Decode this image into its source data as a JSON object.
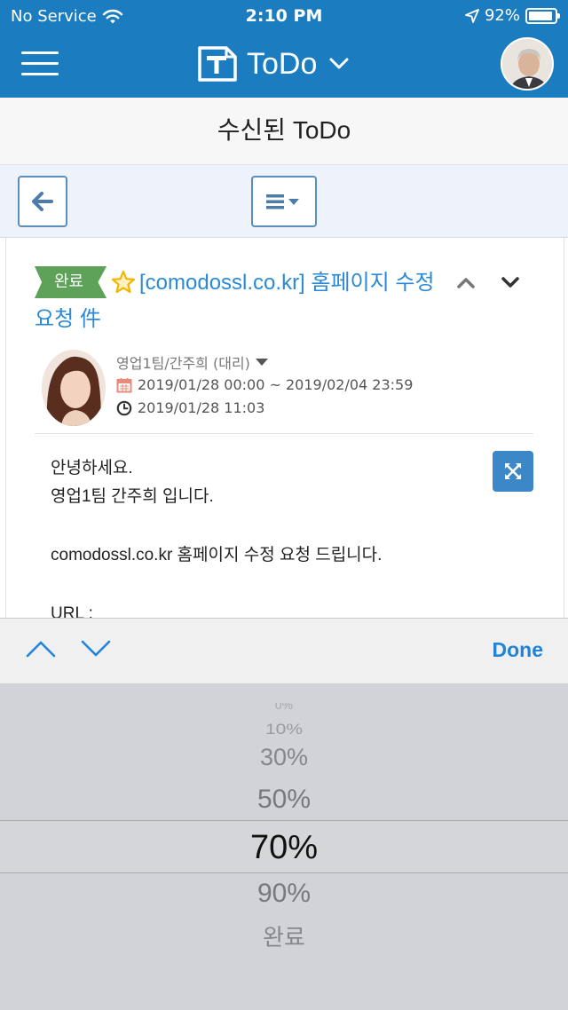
{
  "status_bar": {
    "carrier": "No Service",
    "time": "2:10 PM",
    "battery": "92%",
    "battery_level": 0.92
  },
  "nav": {
    "app_title": "ToDo"
  },
  "page": {
    "title": "수신된 ToDo"
  },
  "todo": {
    "status_badge": "완료",
    "subject": "[comodossl.co.kr] 홈페이지 수정 요청 件",
    "sender": "영업1팀/간주희 (대리)",
    "period": "2019/01/28 00:00 ~ 2019/02/04 23:59",
    "created": "2019/01/28 11:03",
    "body": {
      "line1": "안녕하세요.",
      "line2": "영업1팀 간주희 입니다.",
      "line3": "comodossl.co.kr 홈페이지 수정 요청 드립니다.",
      "line4": "URL :"
    }
  },
  "accessory": {
    "done_label": "Done"
  },
  "picker": {
    "options": [
      "0%",
      "10%",
      "30%",
      "50%",
      "70%",
      "90%",
      "완료"
    ],
    "selected": "70%"
  },
  "colors": {
    "header_bg": "#1b7dbf",
    "link_blue": "#2b8ad6",
    "badge_green": "#5ea25a",
    "star_yellow": "#f5b400"
  }
}
